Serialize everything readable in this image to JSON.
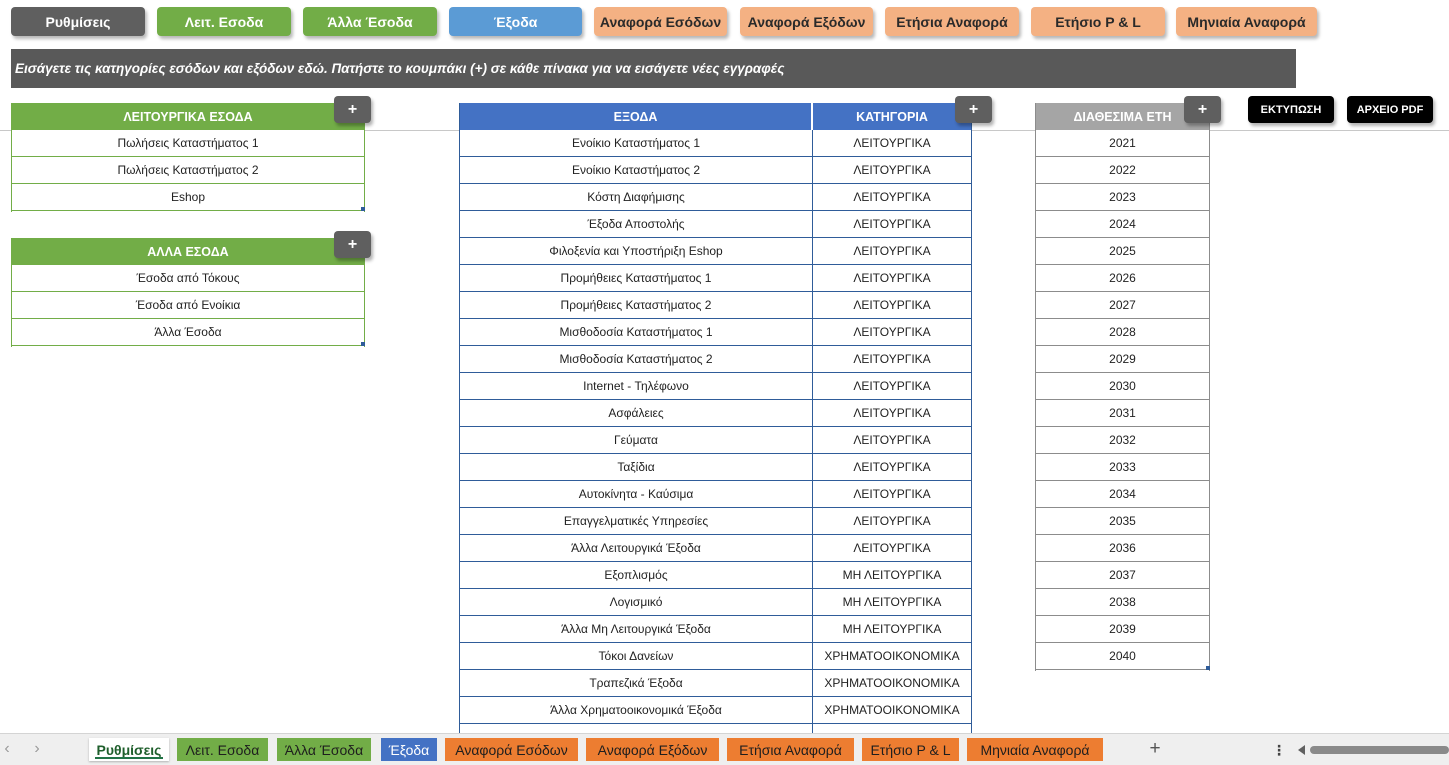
{
  "nav_buttons": [
    {
      "label": "Ρυθμίσεις"
    },
    {
      "label": "Λειτ. Εσοδα"
    },
    {
      "label": "Άλλα Έσοδα"
    },
    {
      "label": "Έξοδα"
    },
    {
      "label": "Αναφορά Εσόδων"
    },
    {
      "label": "Αναφορά Εξόδων"
    },
    {
      "label": "Ετήσια Αναφορά"
    },
    {
      "label": "Ετήσιο P & L"
    },
    {
      "label": "Μηνιαία Αναφορά"
    }
  ],
  "banner": {
    "text": "Εισάγετε τις κατηγορίες εσόδων και εξόδων εδώ. Πατήστε το κουμπάκι (+) σε κάθε πίνακα για να εισάγετε νέες εγγραφές"
  },
  "plus_label": "+",
  "operating_income": {
    "header": "ΛΕΙΤΟΥΡΓΙΚΑ ΕΣΟΔΑ",
    "rows": [
      "Πωλήσεις Καταστήματος 1",
      "Πωλήσεις Καταστήματος 2",
      "Eshop"
    ]
  },
  "other_income": {
    "header": "ΑΛΛΑ ΕΣΟΔΑ",
    "rows": [
      "Έσοδα από Τόκους",
      "Έσοδα από Ενοίκια",
      "Άλλα Έσοδα"
    ]
  },
  "expenses": {
    "header_name": "ΕΞΟΔΑ",
    "header_category": "ΚΑΤΗΓΟΡΙΑ",
    "rows": [
      {
        "name": "Ενοίκιο Καταστήματος 1",
        "category": "ΛΕΙΤΟΥΡΓΙΚΑ"
      },
      {
        "name": "Ενοίκιο Καταστήματος 2",
        "category": "ΛΕΙΤΟΥΡΓΙΚΑ"
      },
      {
        "name": "Κόστη Διαφήμισης",
        "category": "ΛΕΙΤΟΥΡΓΙΚΑ"
      },
      {
        "name": "Έξοδα Αποστολής",
        "category": "ΛΕΙΤΟΥΡΓΙΚΑ"
      },
      {
        "name": "Φιλοξενία και Υποστήριξη Eshop",
        "category": "ΛΕΙΤΟΥΡΓΙΚΑ"
      },
      {
        "name": "Προμήθειες Καταστήματος 1",
        "category": "ΛΕΙΤΟΥΡΓΙΚΑ"
      },
      {
        "name": "Προμήθειες Καταστήματος 2",
        "category": "ΛΕΙΤΟΥΡΓΙΚΑ"
      },
      {
        "name": "Μισθοδοσία Καταστήματος 1",
        "category": "ΛΕΙΤΟΥΡΓΙΚΑ"
      },
      {
        "name": "Μισθοδοσία Καταστήματος 2",
        "category": "ΛΕΙΤΟΥΡΓΙΚΑ"
      },
      {
        "name": "Internet - Τηλέφωνο",
        "category": "ΛΕΙΤΟΥΡΓΙΚΑ"
      },
      {
        "name": "Ασφάλειες",
        "category": "ΛΕΙΤΟΥΡΓΙΚΑ"
      },
      {
        "name": "Γεύματα",
        "category": "ΛΕΙΤΟΥΡΓΙΚΑ"
      },
      {
        "name": "Ταξίδια",
        "category": "ΛΕΙΤΟΥΡΓΙΚΑ"
      },
      {
        "name": "Αυτοκίνητα - Καύσιμα",
        "category": "ΛΕΙΤΟΥΡΓΙΚΑ"
      },
      {
        "name": "Επαγγελματικές Υπηρεσίες",
        "category": "ΛΕΙΤΟΥΡΓΙΚΑ"
      },
      {
        "name": "Άλλα Λειτουργικά Έξοδα",
        "category": "ΛΕΙΤΟΥΡΓΙΚΑ"
      },
      {
        "name": "Εξοπλισμός",
        "category": "ΜΗ ΛΕΙΤΟΥΡΓΙΚΑ"
      },
      {
        "name": "Λογισμικό",
        "category": "ΜΗ ΛΕΙΤΟΥΡΓΙΚΑ"
      },
      {
        "name": "Άλλα Μη Λειτουργικά Έξοδα",
        "category": "ΜΗ ΛΕΙΤΟΥΡΓΙΚΑ"
      },
      {
        "name": "Τόκοι Δανείων",
        "category": "ΧΡΗΜΑΤΟΟΙΚΟΝΟΜΙΚΑ"
      },
      {
        "name": "Τραπεζικά Έξοδα",
        "category": "ΧΡΗΜΑΤΟΟΙΚΟΝΟΜΙΚΑ"
      },
      {
        "name": "Άλλα Χρηματοοικονομικά Έξοδα",
        "category": "ΧΡΗΜΑΤΟΟΙΚΟΝΟΜΙΚΑ"
      }
    ]
  },
  "years": {
    "header": "ΔΙΑΘΕΣΙΜΑ ΕΤΗ",
    "rows": [
      "2021",
      "2022",
      "2023",
      "2024",
      "2025",
      "2026",
      "2027",
      "2028",
      "2029",
      "2030",
      "2031",
      "2032",
      "2033",
      "2034",
      "2035",
      "2036",
      "2037",
      "2038",
      "2039",
      "2040"
    ]
  },
  "print_button": "ΕΚΤΥΠΩΣΗ",
  "pdf_button": "ΑΡΧΕΙΟ PDF",
  "sheet_tabs": [
    {
      "label": "Ρυθμίσεις"
    },
    {
      "label": "Λειτ. Εσοδα"
    },
    {
      "label": "Άλλα Έσοδα"
    },
    {
      "label": "Έξοδα"
    },
    {
      "label": "Αναφορά Εσόδων"
    },
    {
      "label": "Αναφορά Εξόδων"
    },
    {
      "label": "Ετήσια Αναφορά"
    },
    {
      "label": "Ετήσιο P & L"
    },
    {
      "label": "Μηνιαία Αναφορά"
    }
  ],
  "tabbar": {
    "prev_glyph": "‹",
    "next_glyph": "›",
    "add_glyph": "+",
    "more_glyph": "⋮"
  },
  "colors": {
    "gray": "#5f5f5f",
    "green": "#72ad47",
    "blue_button": "#5b9bd5",
    "blue_header": "#4472c4",
    "orange_button": "#f4b183",
    "orange_tab": "#ed7d31",
    "banner": "#595959"
  }
}
